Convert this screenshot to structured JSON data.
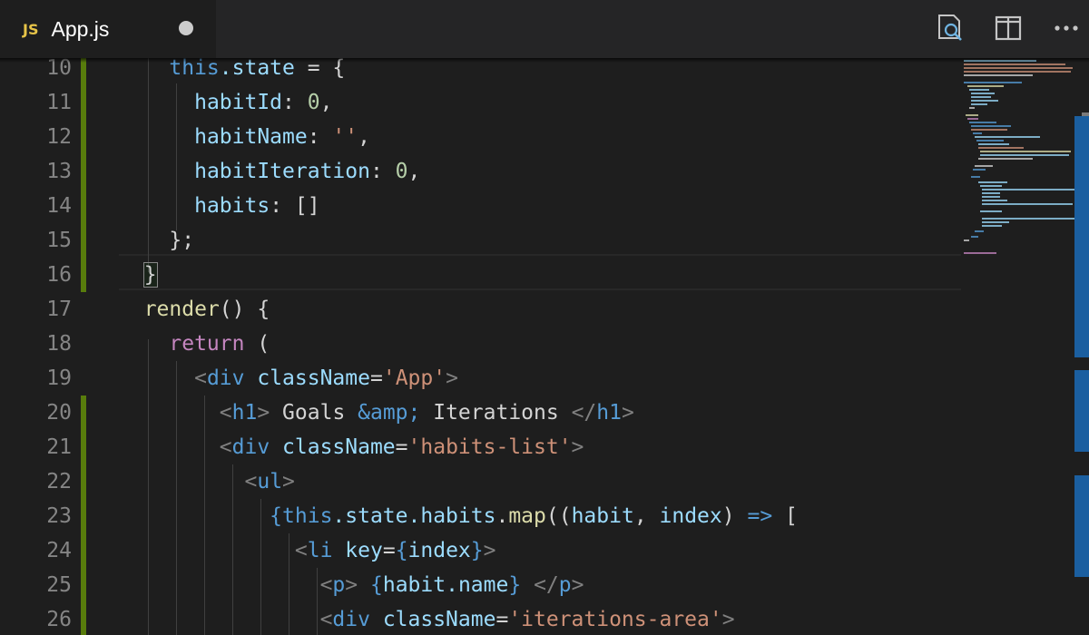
{
  "tab": {
    "icon_label": "JS",
    "title": "App.js",
    "dirty": true
  },
  "toolbar": {
    "actions": [
      {
        "name": "search-icon"
      },
      {
        "name": "split-editor-icon"
      },
      {
        "name": "more-actions-icon"
      }
    ]
  },
  "colors": {
    "tab_icon": "#e7c448",
    "git_modified": "#587c0c",
    "keyword": "#569cd6",
    "control": "#c586c0",
    "variable": "#9cdcfe",
    "function": "#dcdcaa",
    "string": "#ce9178",
    "number": "#b5cea8"
  },
  "editor": {
    "lines": [
      {
        "num": "10"
      },
      {
        "num": "11"
      },
      {
        "num": "12"
      },
      {
        "num": "13"
      },
      {
        "num": "14"
      },
      {
        "num": "15"
      },
      {
        "num": "16"
      },
      {
        "num": "17"
      },
      {
        "num": "18"
      },
      {
        "num": "19"
      },
      {
        "num": "20"
      },
      {
        "num": "21"
      },
      {
        "num": "22"
      },
      {
        "num": "23"
      },
      {
        "num": "24"
      },
      {
        "num": "25"
      },
      {
        "num": "26"
      }
    ],
    "code": {
      "l10": {
        "this": "this",
        "prop": ".state",
        "rest": " = {"
      },
      "l11": {
        "key": "habitId",
        "colon": ": ",
        "val": "0",
        "end": ","
      },
      "l12": {
        "key": "habitName",
        "colon": ": ",
        "val": "''",
        "end": ","
      },
      "l13": {
        "key": "habitIteration",
        "colon": ": ",
        "val": "0",
        "end": ","
      },
      "l14": {
        "key": "habits",
        "colon": ": ",
        "val": "[]"
      },
      "l15": {
        "text": "};"
      },
      "l16": {
        "text": "}"
      },
      "l17": {
        "fn": "render",
        "rest": "() {"
      },
      "l18": {
        "kw": "return",
        "rest": " ("
      },
      "l19": {
        "open": "<",
        "tag": "div",
        "attr": " className",
        "eq": "=",
        "val": "'App'",
        "close": ">"
      },
      "l20": {
        "open": "<",
        "tag": "h1",
        "gt": ">",
        "text1": " Goals ",
        "entity": "&amp;",
        "text2": " Iterations ",
        "close_open": "</",
        "close_tag": "h1",
        "close": ">"
      },
      "l21": {
        "open": "<",
        "tag": "div",
        "attr": " className",
        "eq": "=",
        "val": "'habits-list'",
        "close": ">"
      },
      "l22": {
        "open": "<",
        "tag": "ul",
        "close": ">"
      },
      "l23": {
        "brace": "{",
        "this": "this",
        "chain1": ".state",
        "chain2": ".habits",
        "dot": ".",
        "fn": "map",
        "p1": "((",
        "arg1": "habit",
        "comma": ", ",
        "arg2": "index",
        "p2": ") ",
        "arrow": "=>",
        "bracket": " ["
      },
      "l24": {
        "open": "<",
        "tag": "li",
        "attr": " key",
        "eq": "=",
        "brace1": "{",
        "expr": "index",
        "brace2": "}",
        "close": ">"
      },
      "l25": {
        "open": "<",
        "tag": "p",
        "gt": ">",
        "sp": " ",
        "brace1": "{",
        "expr": "habit.name",
        "brace2": "}",
        "sp2": " ",
        "close_open": "</",
        "close_tag": "p",
        "close": ">"
      },
      "l26": {
        "open": "<",
        "tag": "div",
        "attr": " className",
        "eq": "=",
        "val": "'iterations-area'",
        "close": ">"
      }
    }
  }
}
